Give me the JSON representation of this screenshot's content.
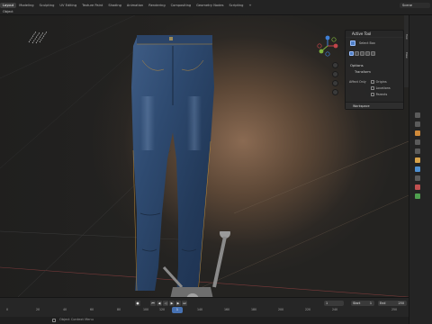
{
  "topbar": {
    "workspace_tabs": [
      "Layout",
      "Modeling",
      "Sculpting",
      "UV Editing",
      "Texture Paint",
      "Shading",
      "Animation",
      "Rendering",
      "Compositing",
      "Geometry Nodes",
      "Scripting",
      "+"
    ],
    "scene": "Scene"
  },
  "header": {
    "object_mode": "Object",
    "transform_orientation": "Global",
    "options": "Options"
  },
  "viewport": {
    "view_label": "View",
    "side_tabs": [
      "Tool",
      "View"
    ]
  },
  "npanel": {
    "active_tool": "Active Tool",
    "tool_name": "Select Box",
    "options": "Options",
    "transform": "Transform",
    "affect_only": "Affect Only",
    "checks": [
      "Origins",
      "Locations",
      "Parents"
    ],
    "workspace": "Workspace"
  },
  "timeline": {
    "current_frame": "1",
    "start_label": "Start",
    "start_value": "1",
    "end_label": "End",
    "end_value": "250",
    "playhead_frame": "1",
    "ticks": [
      "0",
      "20",
      "40",
      "60",
      "80",
      "100",
      "120",
      "140",
      "160",
      "180",
      "200",
      "220",
      "240",
      "250"
    ]
  },
  "statusbar": {
    "context_menu": "Object Context Menu"
  },
  "colors": {
    "accent": "#4772b3",
    "x_axis": "#c2454a",
    "y_axis": "#7fb33d",
    "z_axis": "#3f7fd5"
  }
}
